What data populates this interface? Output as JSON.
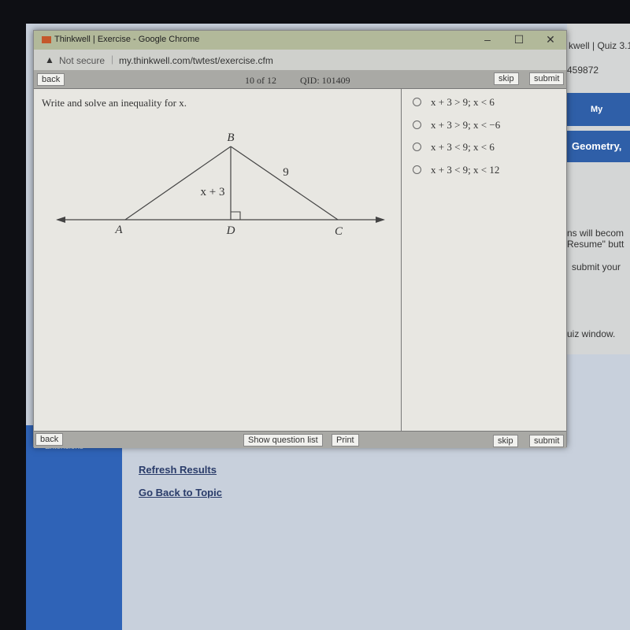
{
  "background_page": {
    "tab_title": "kwell | Quiz 3.1 -",
    "id_fragment": "459872",
    "nav_my_grades": "My Grade",
    "nav_course": "Geometry, ",
    "text_lines": [
      "ns will becom",
      "Resume\" butt",
      "submit your",
      "uiz window."
    ],
    "sidebar_item": "Extensions",
    "links": [
      "Refresh Results",
      "Go Back to Topic"
    ]
  },
  "window": {
    "title": "Thinkwell | Exercise - Google Chrome",
    "not_secure": "Not secure",
    "url": "my.thinkwell.com/twtest/exercise.cfm",
    "controls": {
      "minimize": "–",
      "maximize": "☐",
      "close": "✕"
    }
  },
  "toolbar": {
    "back": "back",
    "progress": "10 of 12",
    "qid": "QID: 101409",
    "skip": "skip",
    "submit": "submit"
  },
  "question": {
    "prompt": "Write and solve an inequality for x.",
    "diagram": {
      "points": [
        "A",
        "B",
        "C",
        "D"
      ],
      "side_BC": "9",
      "side_BD": "x + 3"
    },
    "options": [
      "x + 3 > 9; x < 6",
      "x + 3 > 9; x < −6",
      "x + 3 < 9; x < 6",
      "x + 3 < 9; x < 12"
    ],
    "selected": null
  },
  "bottom_bar": {
    "back": "back",
    "show_list": "Show question list",
    "print": "Print",
    "skip": "skip",
    "submit": "submit"
  }
}
